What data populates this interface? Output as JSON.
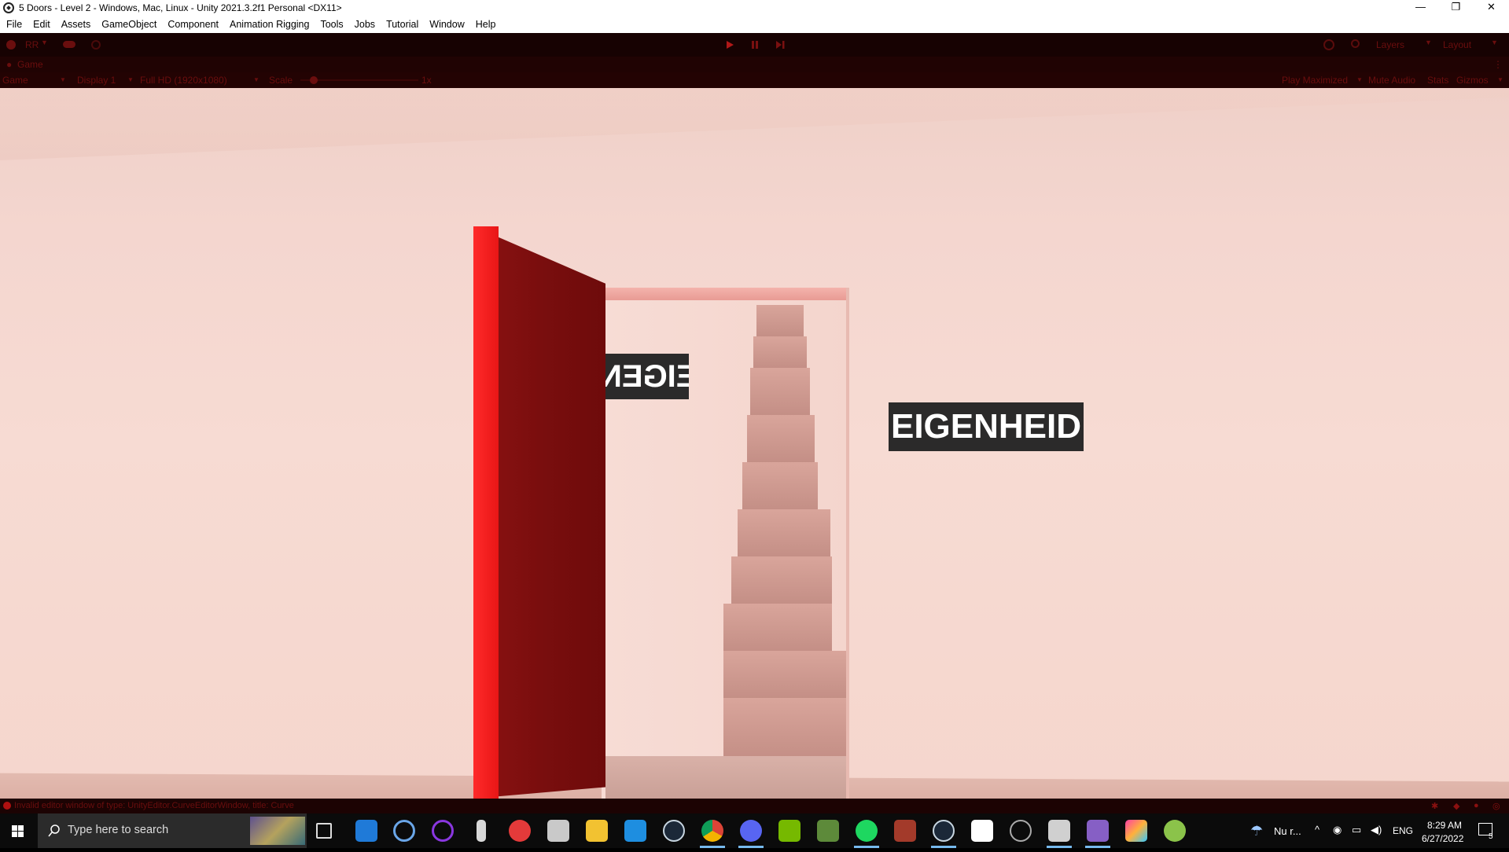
{
  "window": {
    "title": "5 Doors - Level 2 - Windows, Mac, Linux - Unity 2021.3.2f1 Personal <DX11>",
    "minimize_label": "—",
    "restore_label": "❐",
    "close_label": "✕"
  },
  "menu": [
    "File",
    "Edit",
    "Assets",
    "GameObject",
    "Component",
    "Animation Rigging",
    "Tools",
    "Jobs",
    "Tutorial",
    "Window",
    "Help"
  ],
  "toolbar": {
    "account_label": "RR",
    "layers_label": "Layers",
    "layout_label": "Layout"
  },
  "game_tab": {
    "tab_label": "Game",
    "view_select": "Game",
    "display_select": "Display 1",
    "resolution_select": "Full HD (1920x1080)",
    "scale_label": "Scale",
    "scale_value": "1x",
    "play_maximized": "Play Maximized",
    "mute_audio": "Mute Audio",
    "stats": "Stats",
    "gizmos": "Gizmos"
  },
  "scene": {
    "sign_main_text": "EIGENHEID",
    "sign_mirror_text": "EIGEN",
    "colors": {
      "door": "#7a0e0e",
      "door_edge": "#ff2020",
      "wall": "#f5d6cd",
      "sign_bg": "#2b2a2a"
    }
  },
  "console": {
    "message": "Invalid editor window of type: UnityEditor.CurveEditorWindow, title: Curve"
  },
  "taskbar": {
    "search_placeholder": "Type here to search",
    "weather": "Nu r...",
    "language": "ENG",
    "time": "8:29 AM",
    "date": "6/27/2022",
    "notification_count": "5"
  }
}
